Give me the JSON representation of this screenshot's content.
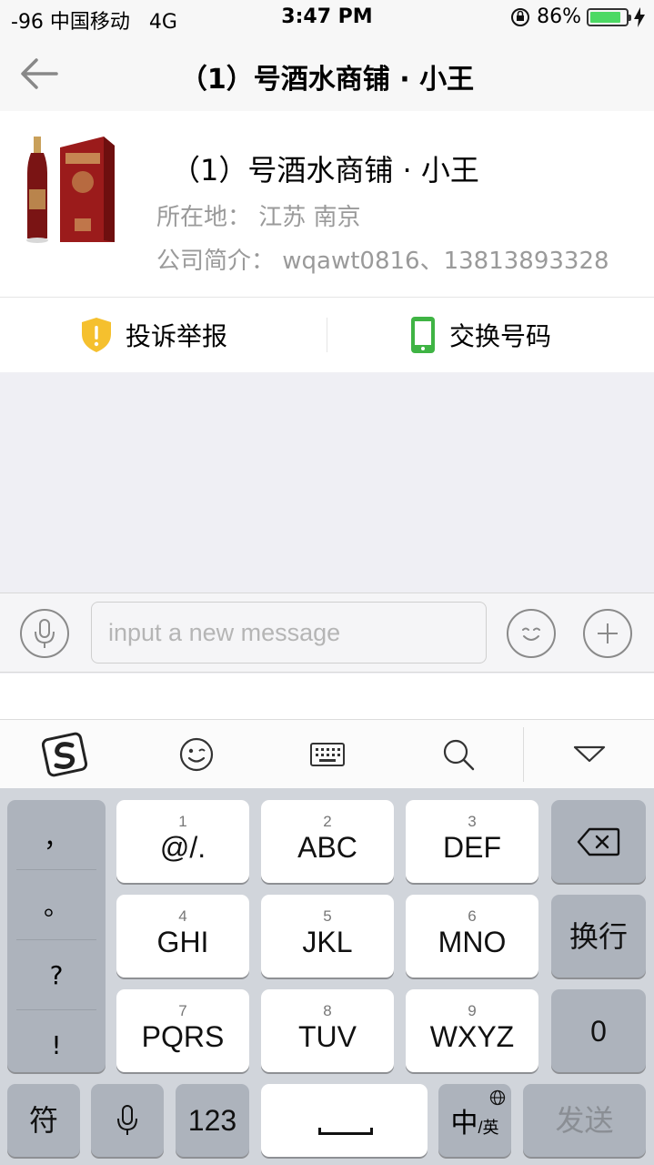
{
  "status_bar": {
    "carrier": "-96 中国移动",
    "network": "4G",
    "time": "3:47 PM",
    "battery_percent": "86%",
    "battery_level": 0.86
  },
  "nav": {
    "title": "（1）号酒水商铺 · 小王",
    "back_icon": "back-arrow-icon"
  },
  "shop": {
    "name": "（1）号酒水商铺 · 小王",
    "location": "所在地：  江苏 南京",
    "intro": "公司简介：  wqawt0816、13813893328"
  },
  "actions": {
    "report_label": "投诉举报",
    "swap_label": "交换号码"
  },
  "composer": {
    "placeholder": "input a new message"
  },
  "keyboard": {
    "punctuation": [
      "，",
      "。",
      "?",
      "!"
    ],
    "keys": [
      {
        "num": "1",
        "label": "@/."
      },
      {
        "num": "2",
        "label": "ABC"
      },
      {
        "num": "3",
        "label": "DEF"
      },
      {
        "num": "4",
        "label": "GHI"
      },
      {
        "num": "5",
        "label": "JKL"
      },
      {
        "num": "6",
        "label": "MNO"
      },
      {
        "num": "7",
        "label": "PQRS"
      },
      {
        "num": "8",
        "label": "TUV"
      },
      {
        "num": "9",
        "label": "WXYZ"
      }
    ],
    "newline_label": "换行",
    "zero_label": "0",
    "symbols_label": "符",
    "numbers_label": "123",
    "lang_main": "中",
    "lang_sub": "/英",
    "send_label": "发送"
  },
  "colors": {
    "shield": "#f5c02e",
    "phone": "#3fb444",
    "battery": "#4cd964"
  }
}
